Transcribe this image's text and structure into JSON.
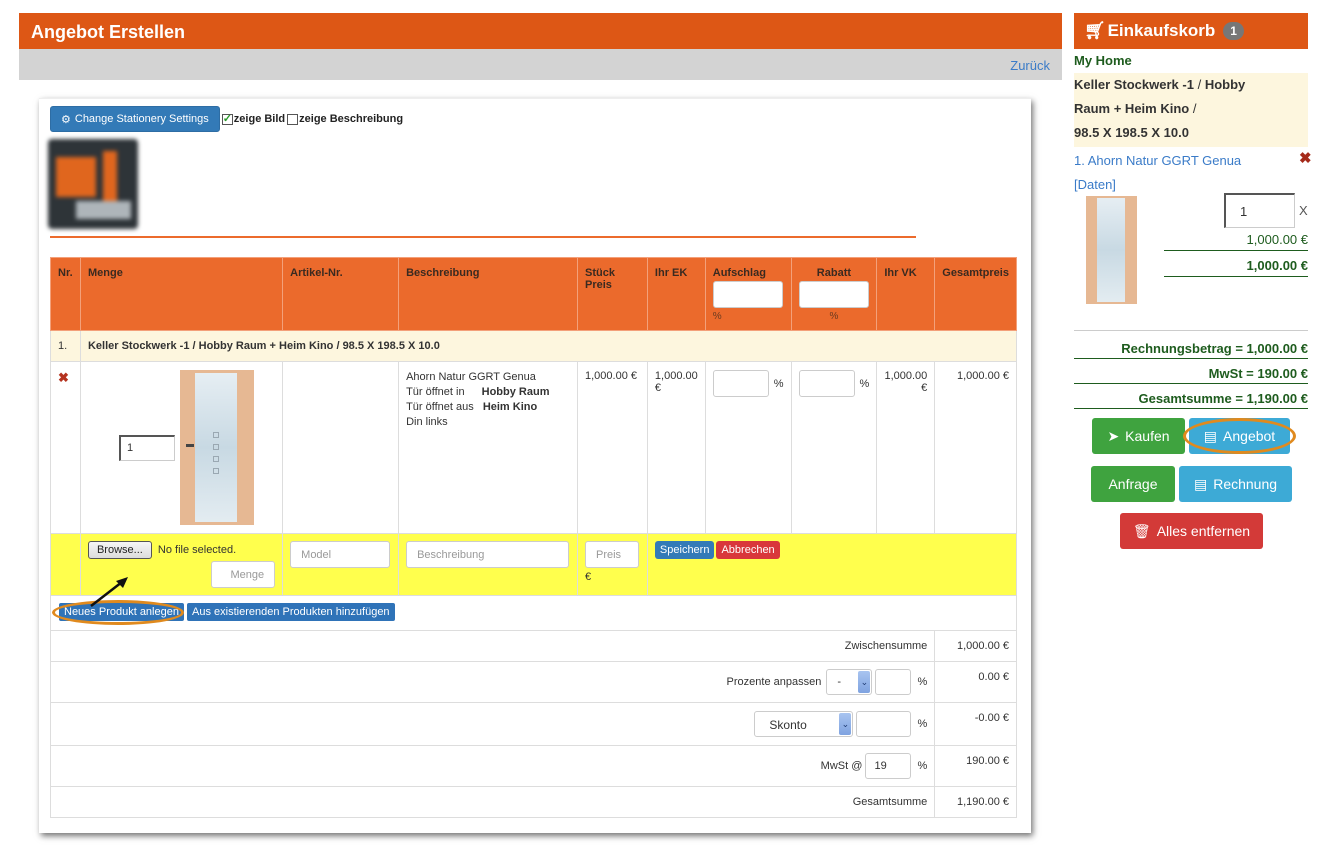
{
  "header": {
    "title": "Angebot Erstellen",
    "back_link": "Zurück"
  },
  "toolbar": {
    "stationery_button": "Change Stationery Settings",
    "show_image_label": "zeige Bild",
    "show_image_checked": true,
    "show_description_label": "zeige Beschreibung",
    "show_description_checked": false
  },
  "table": {
    "columns": [
      "Nr.",
      "Menge",
      "Artikel-Nr.",
      "Beschreibung",
      "Stück Preis",
      "Ihr EK",
      "Aufschlag",
      "Rabatt",
      "Ihr VK",
      "Gesamtpreis"
    ],
    "percent_symbol": "%",
    "group": {
      "nr": "1.",
      "title": "Keller Stockwerk -1 / Hobby Raum + Heim Kino / 98.5 X 198.5 X 10.0"
    },
    "item": {
      "quantity": "1",
      "article_no": "",
      "description": {
        "name": "Ahorn Natur GGRT Genua",
        "opens_in_label": "Tür öffnet in",
        "opens_in_value": "Hobby Raum",
        "opens_out_label": "Tür öffnet aus",
        "opens_out_value": "Heim Kino",
        "din": "Din links"
      },
      "unit_price": "1,000.00 €",
      "ek": "1,000.00 €",
      "vk": "1,000.00 €",
      "total": "1,000.00 €"
    },
    "new_row": {
      "browse_button": "Browse...",
      "no_file": "No file selected.",
      "quantity_placeholder": "Menge",
      "model_placeholder": "Model",
      "description_placeholder": "Beschreibung",
      "price_placeholder": "Preis",
      "currency": "€",
      "save_button": "Speichern",
      "cancel_button": "Abbrechen"
    },
    "actions": {
      "new_product": "Neues Produkt anlegen",
      "add_existing": "Aus existierenden Produkten hinzufügen"
    },
    "summary": {
      "subtotal_label": "Zwischensumme",
      "subtotal_value": "1,000.00 €",
      "adjust_label": "Prozente anpassen",
      "adjust_select": "-",
      "adjust_value": "0.00 €",
      "discount_select": "Skonto",
      "discount_value": "-0.00 €",
      "vat_label": "MwSt @",
      "vat_rate": "19",
      "vat_value": "190.00 €",
      "total_label": "Gesamtsumme",
      "total_value": "1,190.00 €"
    }
  },
  "cart": {
    "title": "Einkaufskorb",
    "count": "1",
    "home": "My Home",
    "room_line1": "Keller Stockwerk -1",
    "room_line1b": "Hobby",
    "room_line2": "Raum + Heim Kino",
    "room_line3": "98.5 X 198.5 X 10.0",
    "slash": "/",
    "item_name": "1. Ahorn Natur GGRT Genua",
    "item_data_link": "[Daten]",
    "quantity": "1",
    "times": "X",
    "unit_price": "1,000.00 €",
    "line_total": "1,000.00 €",
    "invoice_amount": "Rechnungsbetrag = 1,000.00 €",
    "vat": "MwSt = 190.00 €",
    "grand_total": "Gesamtsumme = 1,190.00 €",
    "buttons": {
      "buy": "Kaufen",
      "offer": "Angebot",
      "inquiry": "Anfrage",
      "invoice": "Rechnung",
      "remove_all": "Alles entfernen"
    },
    "colors": {
      "green": "#3fa33f",
      "cyan": "#3daad6",
      "red": "#d33a38",
      "header": "#dd5715"
    }
  }
}
